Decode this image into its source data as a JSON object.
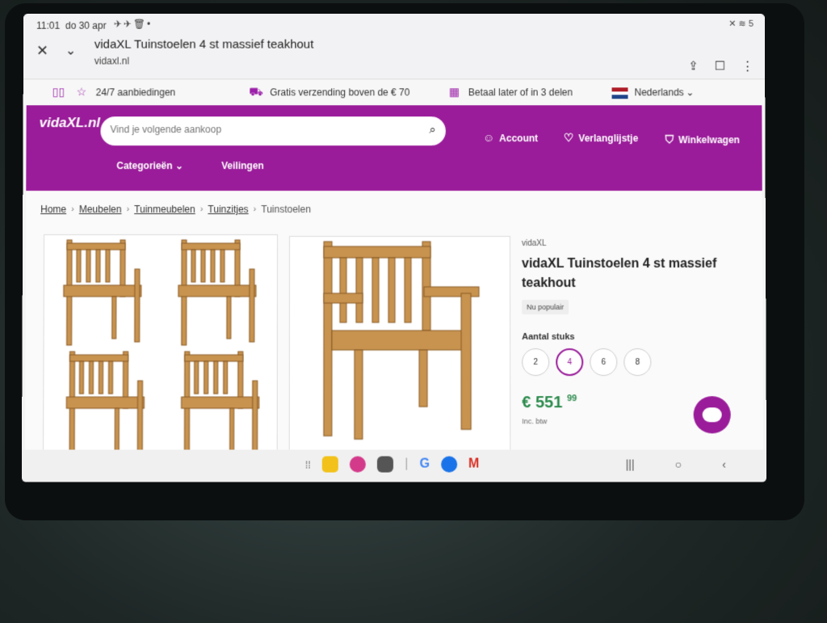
{
  "status": {
    "time": "11:01",
    "date": "do 30 apr",
    "battery": "5"
  },
  "browser": {
    "title": "vidaXL Tuinstoelen 4 st massief teakhout",
    "url": "vidaxl.nl"
  },
  "infostrip": {
    "deals": "24/7 aanbiedingen",
    "shipping": "Gratis verzending boven de € 70",
    "pay_later": "Betaal later of in 3 delen",
    "language": "Nederlands"
  },
  "header": {
    "logo": "vidaXL.nl",
    "search_placeholder": "Vind je volgende aankoop",
    "account": "Account",
    "wishlist": "Verlanglijstje",
    "cart": "Winkelwagen",
    "categories": "Categorieën",
    "auctions": "Veilingen"
  },
  "breadcrumb": [
    "Home",
    "Meubelen",
    "Tuinmeubelen",
    "Tuinzitjes",
    "Tuinstoelen"
  ],
  "product": {
    "brand": "vidaXL",
    "title": "vidaXL Tuinstoelen 4 st massief teakhout",
    "badge": "Nu populair",
    "quantity_label": "Aantal stuks",
    "quantity_options": [
      "2",
      "4",
      "6",
      "8"
    ],
    "selected_quantity": "4",
    "price_whole": "€ 551",
    "price_cents": "99",
    "vat": "Inc. btw"
  },
  "colors": {
    "brand": "#9a1c9a",
    "price": "#2b8a4c"
  }
}
